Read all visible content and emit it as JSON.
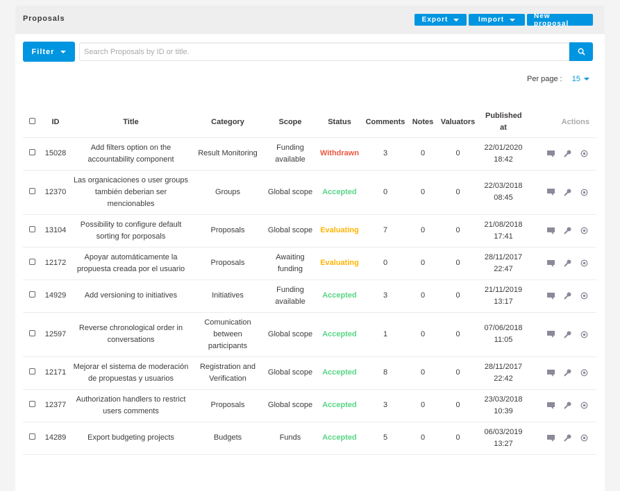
{
  "header": {
    "title": "Proposals",
    "buttons": {
      "export": "Export",
      "import": "Import",
      "new": "New proposal"
    }
  },
  "filter": {
    "label": "Filter",
    "search_placeholder": "Search Proposals by ID or title.",
    "search_value": ""
  },
  "perpage": {
    "label": "Per page :",
    "value": "15"
  },
  "colors": {
    "accent": "#0095e0",
    "withdrawn": "#ec5840",
    "accepted": "#57d685",
    "evaluating": "#ffb502"
  },
  "table": {
    "columns": [
      "ID",
      "Title",
      "Category",
      "Scope",
      "Status",
      "Comments",
      "Notes",
      "Valuators",
      "Published at",
      "Actions"
    ],
    "action_icons": [
      "comment-icon",
      "key-icon",
      "eye-icon"
    ],
    "rows": [
      {
        "id": "15028",
        "title": "Add filters option on the accountability component",
        "category": "Result Monitoring",
        "scope": "Funding available",
        "status": "Withdrawn",
        "status_key": "withdrawn",
        "comments": "3",
        "notes": "0",
        "valuators": "0",
        "date": "22/01/2020",
        "time": "18:42"
      },
      {
        "id": "12370",
        "title": "Las organicaciones o user groups también deberian ser mencionables",
        "category": "Groups",
        "scope": "Global scope",
        "status": "Accepted",
        "status_key": "accepted",
        "comments": "0",
        "notes": "0",
        "valuators": "0",
        "date": "22/03/2018",
        "time": "08:45"
      },
      {
        "id": "13104",
        "title": "Possibility to configure default sorting for porposals",
        "category": "Proposals",
        "scope": "Global scope",
        "status": "Evaluating",
        "status_key": "evaluating",
        "comments": "7",
        "notes": "0",
        "valuators": "0",
        "date": "21/08/2018",
        "time": "17:41"
      },
      {
        "id": "12172",
        "title": "Apoyar automáticamente la propuesta creada por el usuario",
        "category": "Proposals",
        "scope": "Awaiting funding",
        "status": "Evaluating",
        "status_key": "evaluating",
        "comments": "0",
        "notes": "0",
        "valuators": "0",
        "date": "28/11/2017",
        "time": "22:47"
      },
      {
        "id": "14929",
        "title": "Add versioning to initiatives",
        "category": "Initiatives",
        "scope": "Funding available",
        "status": "Accepted",
        "status_key": "accepted",
        "comments": "3",
        "notes": "0",
        "valuators": "0",
        "date": "21/11/2019",
        "time": "13:17"
      },
      {
        "id": "12597",
        "title": "Reverse chronological order in conversations",
        "category": "Comunication between participants",
        "scope": "Global scope",
        "status": "Accepted",
        "status_key": "accepted",
        "comments": "1",
        "notes": "0",
        "valuators": "0",
        "date": "07/06/2018",
        "time": "11:05"
      },
      {
        "id": "12171",
        "title": "Mejorar el sistema de moderación de propuestas y usuarios",
        "category": "Registration and Verification",
        "scope": "Global scope",
        "status": "Accepted",
        "status_key": "accepted",
        "comments": "8",
        "notes": "0",
        "valuators": "0",
        "date": "28/11/2017",
        "time": "22:42"
      },
      {
        "id": "12377",
        "title": "Authorization handlers to restrict users comments",
        "category": "Proposals",
        "scope": "Global scope",
        "status": "Accepted",
        "status_key": "accepted",
        "comments": "3",
        "notes": "0",
        "valuators": "0",
        "date": "23/03/2018",
        "time": "10:39"
      },
      {
        "id": "14289",
        "title": "Export budgeting projects",
        "category": "Budgets",
        "scope": "Funds",
        "status": "Accepted",
        "status_key": "accepted",
        "comments": "5",
        "notes": "0",
        "valuators": "0",
        "date": "06/03/2019",
        "time": "13:27"
      }
    ]
  }
}
